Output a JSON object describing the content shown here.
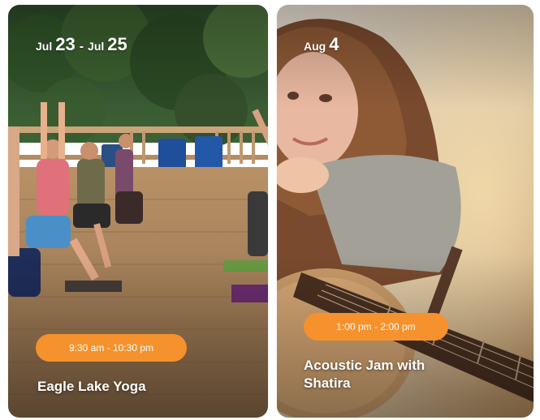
{
  "cards": [
    {
      "date_start_month": "Jul",
      "date_start_day": "23",
      "date_separator": "-",
      "date_end_month": "Jul",
      "date_end_day": "25",
      "time": "9:30 am - 10:30 pm",
      "title": "Eagle Lake Yoga"
    },
    {
      "date_month": "Aug",
      "date_day": "4",
      "time": "1:00 pm - 2:00 pm",
      "title": "Acoustic Jam with Shatira"
    }
  ],
  "colors": {
    "pill": "#f5922d",
    "text": "#ffffff"
  }
}
